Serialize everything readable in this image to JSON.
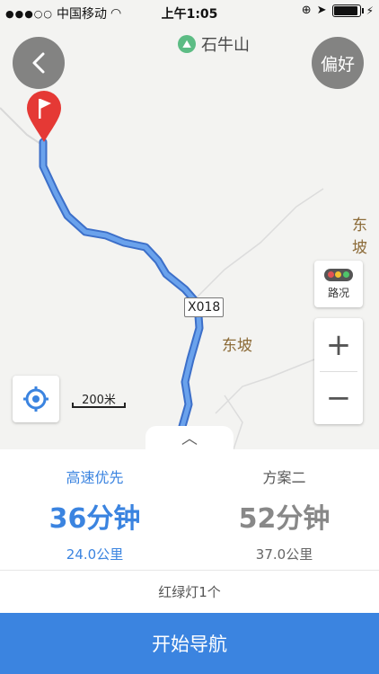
{
  "status_bar": {
    "carrier": "中国移动",
    "time": "上午1:05"
  },
  "map": {
    "place_name": "石牛山",
    "road_code": "X018",
    "towns": [
      "东坡",
      "东坡"
    ],
    "scale_label": "200米",
    "traffic_label": "路况",
    "zoom_in": "+",
    "zoom_out": "−"
  },
  "header": {
    "back_icon": "chevron-left-icon",
    "preference_label": "偏好"
  },
  "routes": [
    {
      "name": "高速优先",
      "duration": "36分钟",
      "distance": "24.0公里",
      "selected": true
    },
    {
      "name": "方案二",
      "duration": "52分钟",
      "distance": "37.0公里",
      "selected": false
    }
  ],
  "traffic_lights_info": "红绿灯1个",
  "start_navigation": "开始导航",
  "colors": {
    "accent": "#3b84e0",
    "route_line": "#5b8ee0",
    "pin": "#e53935"
  }
}
